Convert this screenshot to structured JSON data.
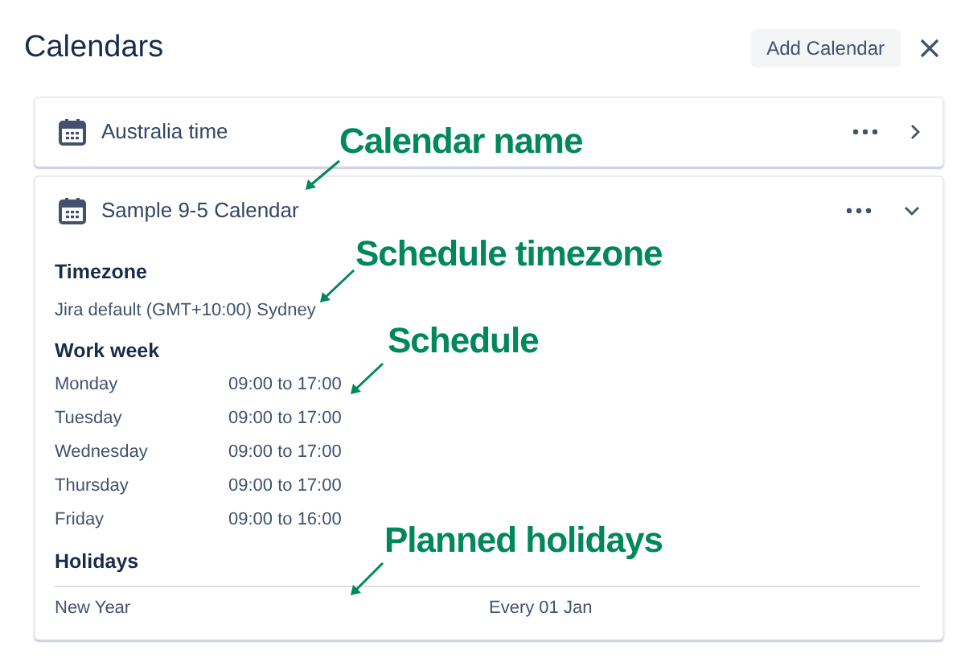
{
  "header": {
    "title": "Calendars",
    "add_button": "Add Calendar"
  },
  "calendars": [
    {
      "name": "Australia time",
      "expanded": false
    },
    {
      "name": "Sample 9-5 Calendar",
      "expanded": true,
      "timezone_heading": "Timezone",
      "timezone": "Jira default (GMT+10:00) Sydney",
      "work_week_heading": "Work week",
      "work_week": [
        {
          "day": "Monday",
          "hours": "09:00 to 17:00"
        },
        {
          "day": "Tuesday",
          "hours": "09:00 to 17:00"
        },
        {
          "day": "Wednesday",
          "hours": "09:00 to 17:00"
        },
        {
          "day": "Thursday",
          "hours": "09:00 to 17:00"
        },
        {
          "day": "Friday",
          "hours": "09:00 to 16:00"
        }
      ],
      "holidays_heading": "Holidays",
      "holidays": [
        {
          "name": "New Year",
          "recurrence": "Every 01 Jan"
        }
      ]
    }
  ],
  "annotations": [
    "Calendar name",
    "Schedule timezone",
    "Schedule",
    "Planned holidays"
  ]
}
